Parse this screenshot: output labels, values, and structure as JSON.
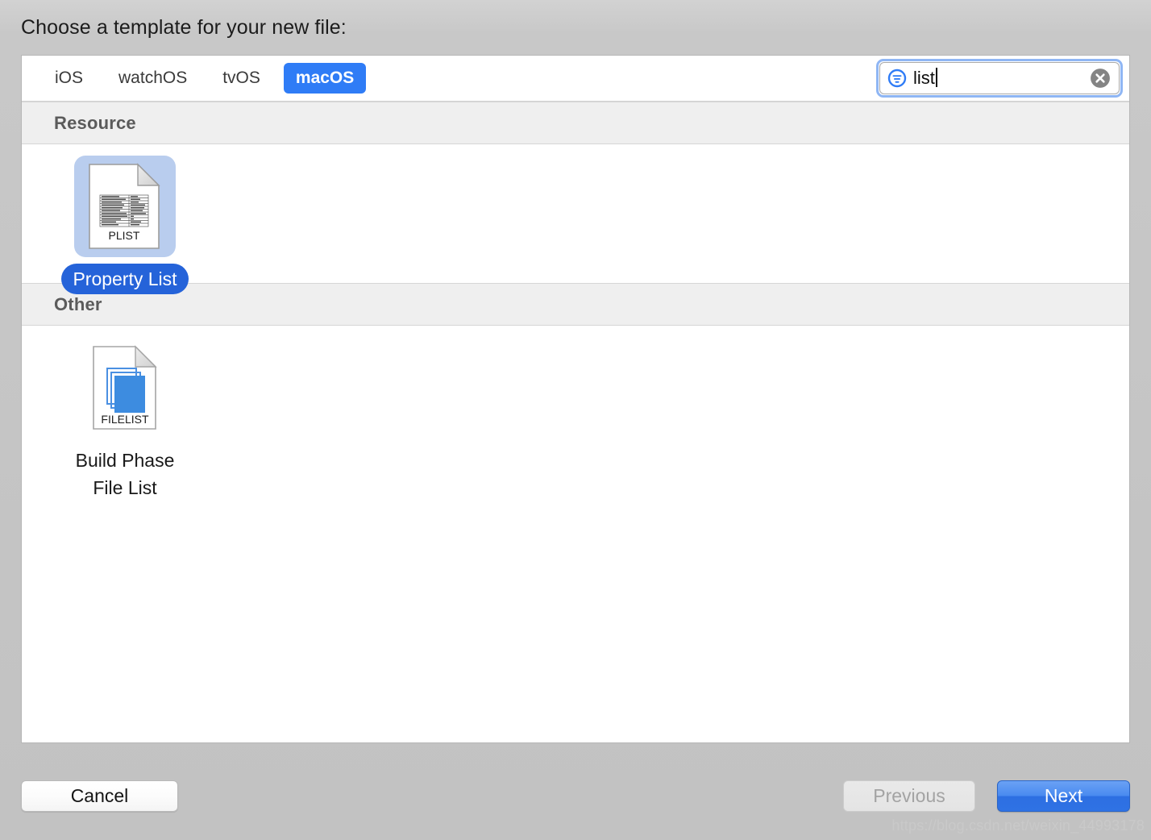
{
  "dialog": {
    "prompt": "Choose a template for your new file:"
  },
  "tabs": [
    {
      "label": "iOS",
      "active": false
    },
    {
      "label": "watchOS",
      "active": false
    },
    {
      "label": "tvOS",
      "active": false
    },
    {
      "label": "macOS",
      "active": true
    }
  ],
  "search": {
    "value": "list",
    "placeholder": "",
    "icon": "search-filter-icon",
    "clear_icon": "clear-circle-icon",
    "focused": true
  },
  "sections": [
    {
      "title": "Resource",
      "items": [
        {
          "label": "Property List",
          "selected": true,
          "icon": "plist-document-icon",
          "icon_caption": "PLIST"
        }
      ]
    },
    {
      "title": "Other",
      "items": [
        {
          "label": "Build Phase File List",
          "selected": false,
          "icon": "filelist-document-icon",
          "icon_caption": "FILELIST"
        }
      ]
    }
  ],
  "footer": {
    "cancel_label": "Cancel",
    "previous_label": "Previous",
    "previous_disabled": true,
    "next_label": "Next"
  },
  "watermark": "https://blog.csdn.net/weixin_44993178",
  "colors": {
    "accent_blue": "#2f7cf6",
    "selected_pill": "#2563d9",
    "selection_bg": "#b9cdee",
    "header_band": "#efefef",
    "window_bg": "#c6c6c6"
  }
}
